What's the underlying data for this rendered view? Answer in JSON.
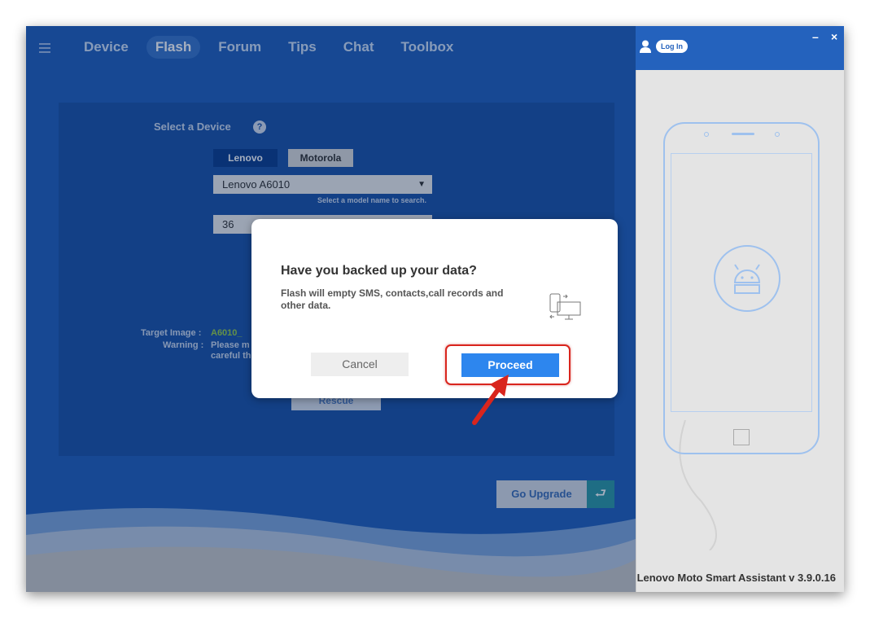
{
  "nav": {
    "items": [
      "Device",
      "Flash",
      "Forum",
      "Tips",
      "Chat",
      "Toolbox"
    ],
    "active": "Flash"
  },
  "header": {
    "login_label": "Log In",
    "minimize_symbol": "–",
    "close_symbol": "×"
  },
  "flash": {
    "select_device_label": "Select a Device",
    "brand_lenovo": "Lenovo",
    "brand_motorola": "Motorola",
    "model_value": "Lenovo A6010",
    "model_hint": "Select a model name to search.",
    "version_value": "36",
    "target_image_label": "Target Image :",
    "target_image_value": "A6010_",
    "warning_label": "Warning :",
    "warning_line1": "Please m",
    "warning_line2": "careful th",
    "rescue_label": "Rescue"
  },
  "footer": {
    "go_upgrade_label": "Go Upgrade",
    "version_text": "Lenovo Moto Smart Assistant v 3.9.0.16"
  },
  "dialog": {
    "title": "Have you backed up your data?",
    "body": "Flash will empty SMS, contacts,call records and other data.",
    "cancel_label": "Cancel",
    "proceed_label": "Proceed"
  },
  "icons": {
    "menu": "hamburger-icon",
    "user": "user-icon",
    "help": "question-icon",
    "dropdown": "triangle-down-icon",
    "back": "return-arrow-icon",
    "android": "android-icon",
    "devices": "phone-computer-icon",
    "annotation": "red-arrow-icon"
  },
  "colors": {
    "primary_blue": "#2462bd",
    "panel_blue": "#1e55a9",
    "proceed_blue": "#2d86ee",
    "highlight_red": "#d9251d",
    "teal": "#2f9aa6"
  }
}
